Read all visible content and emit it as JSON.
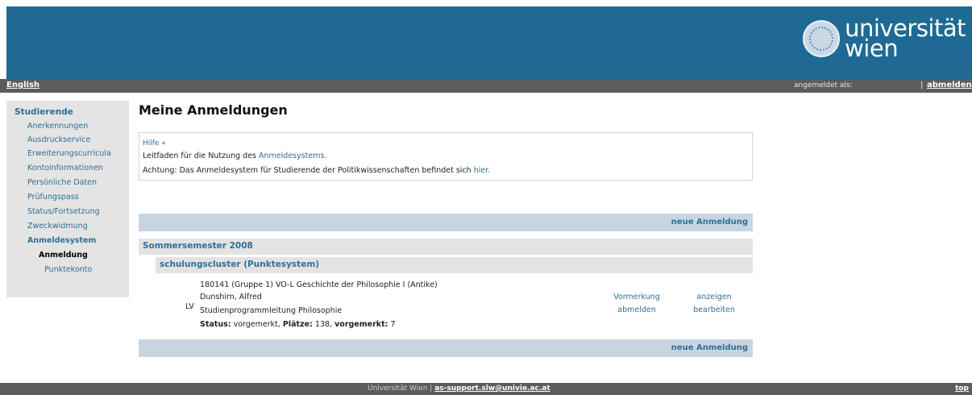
{
  "header": {
    "logo_text_line1": "universität",
    "logo_text_line2": "wien"
  },
  "navbar": {
    "language_link": "English",
    "logged_in_as": "angemeldet als:",
    "separator": "|",
    "logout_link": "abmelden"
  },
  "sidebar": {
    "heading": "Studierende",
    "items": [
      {
        "label": "Anerkennungen"
      },
      {
        "label": "Ausdruckservice"
      },
      {
        "label": "Erweiterungscurricula"
      },
      {
        "label": "Kontoinformationen"
      },
      {
        "label": "Persönliche Daten"
      },
      {
        "label": "Prüfungspass"
      },
      {
        "label": "Status/Fortsetzung"
      },
      {
        "label": "Zweckwidmung"
      },
      {
        "label": "Anmeldesystem"
      },
      {
        "label": "Anmeldung"
      },
      {
        "label": "Punktekonto"
      }
    ]
  },
  "main": {
    "title": "Meine Anmeldungen",
    "info": {
      "help_link": "Hilfe «",
      "guide_text": "Leitfaden für die Nutzung des ",
      "guide_link": "Anmeldesystems.",
      "notice_text": "Achtung: Das Anmeldesystem für Studierende der Politikwissenschaften befindet sich ",
      "notice_link": "hier."
    },
    "new_registration_label": "neue Anmeldung",
    "semester": "Sommersemester 2008",
    "cluster": "schulungscluster (Punktesystem)",
    "entry": {
      "type": "LV",
      "course": "180141 (Gruppe 1) VO-L Geschichte der Philosophie I (Antike)",
      "lecturer": "Dunshirn, Alfred",
      "department": "Studienprogrammleitung Philosophie",
      "status_label": "Status:",
      "status_value": "vorgemerkt",
      "places_label": "Plätze:",
      "places_value": "138",
      "reserved_label": "vorgemerkt:",
      "reserved_value": "7",
      "action1_line1": "Vormerkung",
      "action1_line2": "abmelden",
      "action2_line1": "anzeigen",
      "action2_line2": "bearbeiten"
    }
  },
  "footer": {
    "university": "Universität Wien | ",
    "email": "as-support.slw@univie.ac.at",
    "top_link": "top"
  }
}
